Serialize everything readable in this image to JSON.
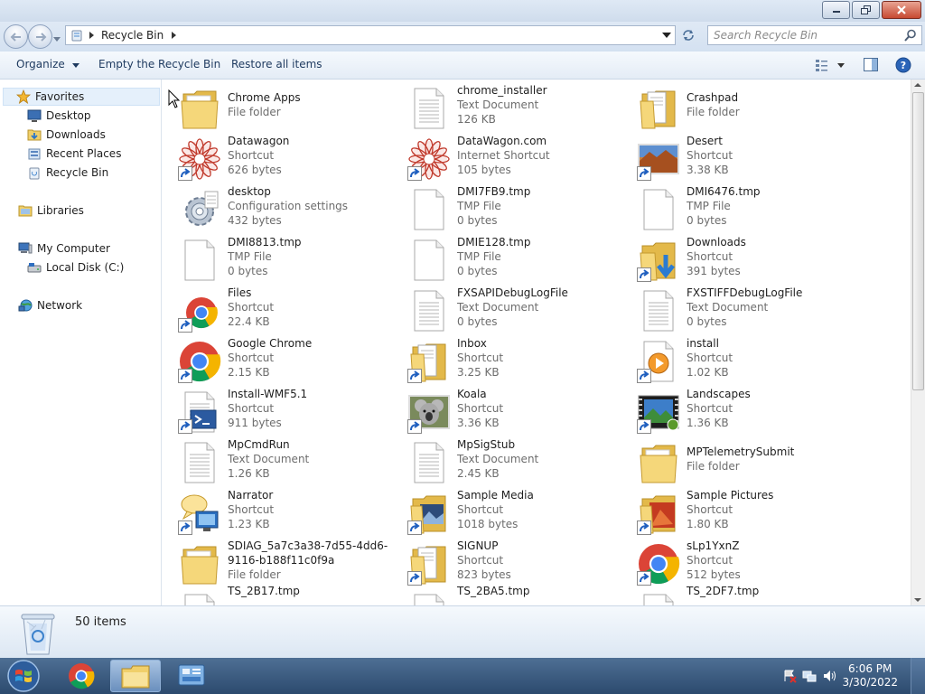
{
  "window": {
    "close_icon": "close-icon",
    "max_icon": "maximize-icon",
    "min_icon": "minimize-icon"
  },
  "address": {
    "location": "Recycle Bin",
    "search_placeholder": "Search Recycle Bin"
  },
  "toolbar": {
    "organize": "Organize",
    "empty": "Empty the Recycle Bin",
    "restore": "Restore all items"
  },
  "sidebar": {
    "favorites": "Favorites",
    "fav_items": [
      "Desktop",
      "Downloads",
      "Recent Places",
      "Recycle Bin"
    ],
    "libraries": "Libraries",
    "computer": "My Computer",
    "local_disk": "Local Disk (C:)",
    "network": "Network"
  },
  "files": [
    {
      "name": "Chrome Apps",
      "type": "File folder",
      "size": "",
      "icon": "folder"
    },
    {
      "name": "chrome_installer",
      "type": "Text Document",
      "size": "126 KB",
      "icon": "doc"
    },
    {
      "name": "Crashpad",
      "type": "File folder",
      "size": "",
      "icon": "folder-doc"
    },
    {
      "name": "Datawagon",
      "type": "Shortcut",
      "size": "626 bytes",
      "icon": "mandala",
      "shortcut": true
    },
    {
      "name": "DataWagon.com",
      "type": "Internet Shortcut",
      "size": "105 bytes",
      "icon": "mandala",
      "shortcut": true
    },
    {
      "name": "Desert",
      "type": "Shortcut",
      "size": "3.38 KB",
      "icon": "desert",
      "shortcut": true
    },
    {
      "name": "desktop",
      "type": "Configuration settings",
      "size": "432 bytes",
      "icon": "gear"
    },
    {
      "name": "DMI7FB9.tmp",
      "type": "TMP File",
      "size": "0 bytes",
      "icon": "blank"
    },
    {
      "name": "DMI6476.tmp",
      "type": "TMP File",
      "size": "0 bytes",
      "icon": "blank"
    },
    {
      "name": "DMI8813.tmp",
      "type": "TMP File",
      "size": "0 bytes",
      "icon": "blank"
    },
    {
      "name": "DMIE128.tmp",
      "type": "TMP File",
      "size": "0 bytes",
      "icon": "blank"
    },
    {
      "name": "Downloads",
      "type": "Shortcut",
      "size": "391 bytes",
      "icon": "downloads",
      "shortcut": true
    },
    {
      "name": "Files",
      "type": "Shortcut",
      "size": "22.4 KB",
      "icon": "chrome-small",
      "shortcut": true
    },
    {
      "name": "FXSAPIDebugLogFile",
      "type": "Text Document",
      "size": "0 bytes",
      "icon": "doc"
    },
    {
      "name": "FXSTIFFDebugLogFile",
      "type": "Text Document",
      "size": "0 bytes",
      "icon": "doc"
    },
    {
      "name": "Google Chrome",
      "type": "Shortcut",
      "size": "2.15 KB",
      "icon": "chrome",
      "shortcut": true
    },
    {
      "name": "Inbox",
      "type": "Shortcut",
      "size": "3.25 KB",
      "icon": "folder-doc",
      "shortcut": true
    },
    {
      "name": "install",
      "type": "Shortcut",
      "size": "1.02 KB",
      "icon": "media",
      "shortcut": true
    },
    {
      "name": "Install-WMF5.1",
      "type": "Shortcut",
      "size": "911 bytes",
      "icon": "powershell",
      "shortcut": true
    },
    {
      "name": "Koala",
      "type": "Shortcut",
      "size": "3.36 KB",
      "icon": "koala",
      "shortcut": true
    },
    {
      "name": "Landscapes",
      "type": "Shortcut",
      "size": "1.36 KB",
      "icon": "landscape",
      "shortcut": true
    },
    {
      "name": "MpCmdRun",
      "type": "Text Document",
      "size": "1.26 KB",
      "icon": "doc"
    },
    {
      "name": "MpSigStub",
      "type": "Text Document",
      "size": "2.45 KB",
      "icon": "doc"
    },
    {
      "name": "MPTelemetrySubmit",
      "type": "File folder",
      "size": "",
      "icon": "folder"
    },
    {
      "name": "Narrator",
      "type": "Shortcut",
      "size": "1.23 KB",
      "icon": "narrator",
      "shortcut": true
    },
    {
      "name": "Sample Media",
      "type": "Shortcut",
      "size": "1018 bytes",
      "icon": "folder-media",
      "shortcut": true
    },
    {
      "name": "Sample Pictures",
      "type": "Shortcut",
      "size": "1.80 KB",
      "icon": "folder-pic",
      "shortcut": true
    },
    {
      "name": "SDIAG_5a7c3a38-7d55-4dd6-9116-b188f11c0f9a",
      "type": "File folder",
      "size": "",
      "icon": "folder"
    },
    {
      "name": "SIGNUP",
      "type": "Shortcut",
      "size": "823 bytes",
      "icon": "folder-doc",
      "shortcut": true
    },
    {
      "name": "sLp1YxnZ",
      "type": "Shortcut",
      "size": "512 bytes",
      "icon": "chrome",
      "shortcut": true
    },
    {
      "name": "TS_2B17.tmp",
      "type": "",
      "size": "",
      "icon": "blank"
    },
    {
      "name": "TS_2BA5.tmp",
      "type": "",
      "size": "",
      "icon": "blank"
    },
    {
      "name": "TS_2DF7.tmp",
      "type": "",
      "size": "",
      "icon": "blank"
    }
  ],
  "details": {
    "count": "50 items"
  },
  "taskbar": {
    "time": "6:06 PM",
    "date": "3/30/2022"
  }
}
